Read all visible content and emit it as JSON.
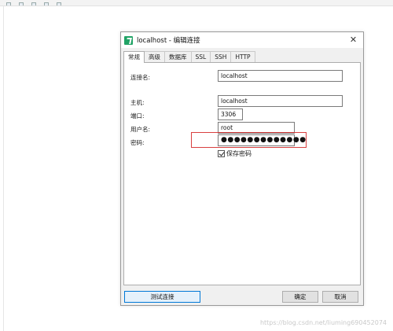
{
  "dialog": {
    "title": "localhost - 编辑连接",
    "close_symbol": "✕",
    "tabs": [
      "常规",
      "高级",
      "数据库",
      "SSL",
      "SSH",
      "HTTP"
    ],
    "form": {
      "connection_name_label": "连接名:",
      "connection_name_value": "localhost",
      "host_label": "主机:",
      "host_value": "localhost",
      "port_label": "端口:",
      "port_value": "3306",
      "username_label": "用户名:",
      "username_value": "root",
      "password_label": "密码:",
      "password_value": "●●●●●●●●●●●●●",
      "save_password_label": "保存密码",
      "save_password_checked": true
    },
    "buttons": {
      "test": "测试连接",
      "ok": "确定",
      "cancel": "取消"
    }
  },
  "watermark": "https://blog.csdn.net/liuming690452074",
  "colors": {
    "highlight": "#d94040",
    "navicat_icon": "#21a366",
    "primary_border": "#0078d7"
  }
}
